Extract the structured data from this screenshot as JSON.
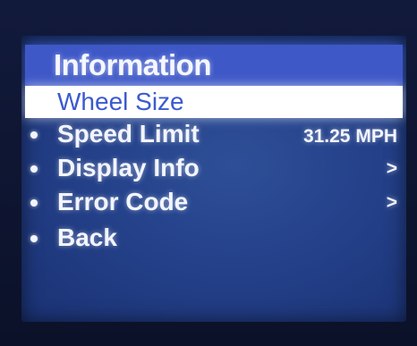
{
  "menu": {
    "title": "Information",
    "items": [
      {
        "label": "Wheel Size",
        "value": "",
        "selected": true,
        "bullet": false
      },
      {
        "label": "Speed Limit",
        "value": "31.25 MPH",
        "selected": false,
        "bullet": true
      },
      {
        "label": "Display Info",
        "value": ">",
        "selected": false,
        "bullet": true
      },
      {
        "label": "Error Code",
        "value": ">",
        "selected": false,
        "bullet": true
      },
      {
        "label": "Back",
        "value": "",
        "selected": false,
        "bullet": true
      }
    ]
  },
  "colors": {
    "screen_background": "#24418a",
    "title_bar": "#3e58c8",
    "selected_row": "#ffffff",
    "selected_text": "#3b5ad0",
    "text": "#f2f5ff"
  }
}
